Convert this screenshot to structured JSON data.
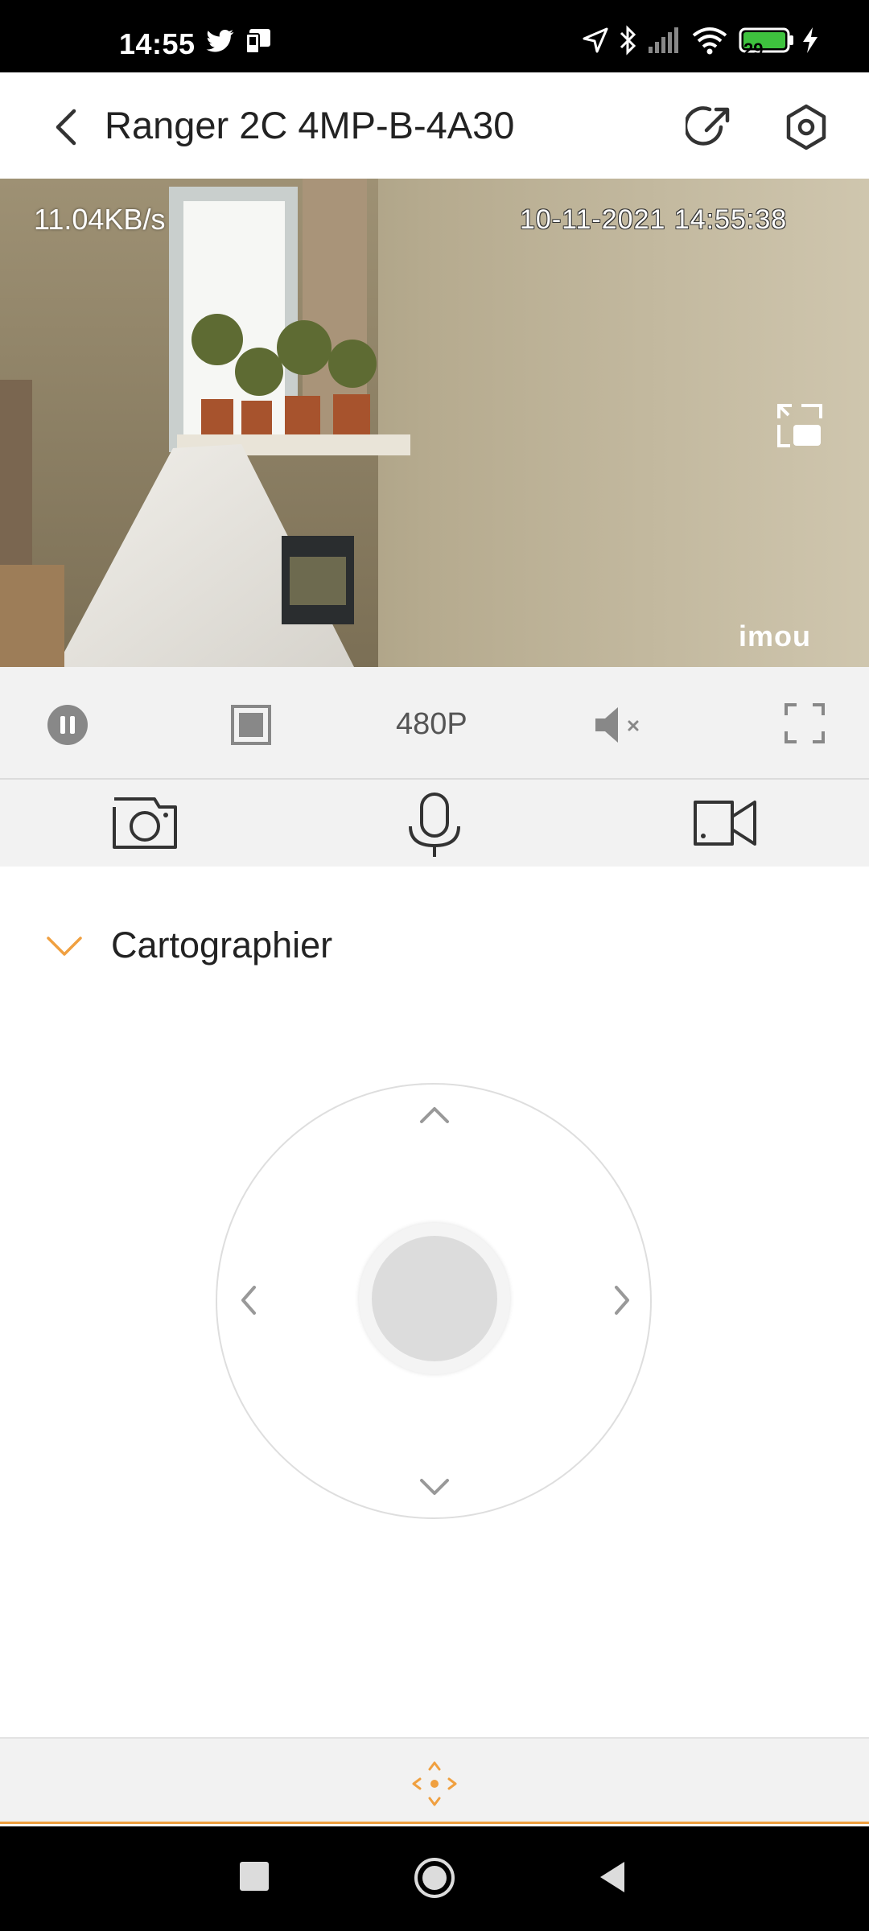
{
  "status_bar": {
    "time": "14:55",
    "battery_level": "29",
    "icons": [
      "twitter-icon",
      "app-notification-icon",
      "location-icon",
      "bluetooth-icon",
      "signal-icon",
      "wifi-icon",
      "battery-icon",
      "charging-icon"
    ]
  },
  "header": {
    "title": "Ranger 2C 4MP-B-4A30",
    "icons": [
      "back-icon",
      "share-icon",
      "settings-icon"
    ]
  },
  "video": {
    "bitrate": "11.04KB/s",
    "timestamp": "10-11-2021 14:55:38",
    "watermark": "imou"
  },
  "controls": {
    "quality": "480P",
    "icons": [
      "pause-icon",
      "stop-icon",
      "mute-icon",
      "fullscreen-icon"
    ]
  },
  "actions": {
    "icons": [
      "camera-icon",
      "microphone-icon",
      "video-record-icon"
    ]
  },
  "section": {
    "title": "Cartographier"
  },
  "ptz": {
    "icons": [
      "arrow-up-icon",
      "arrow-down-icon",
      "arrow-left-icon",
      "arrow-right-icon"
    ]
  },
  "colors": {
    "accent": "#f0a040",
    "status_bar": "#000000",
    "controls_bg": "#f2f2f2"
  }
}
